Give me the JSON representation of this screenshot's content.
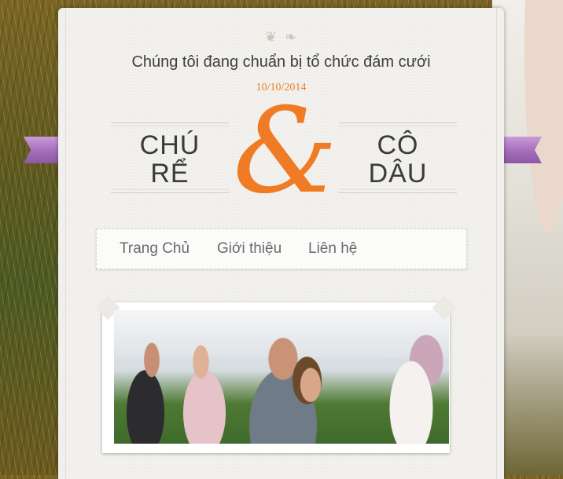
{
  "header": {
    "ornament": "❦ ❧",
    "tagline": "Chúng tôi đang chuẩn bị tổ chức đám cưới",
    "date": "10/10/2014"
  },
  "couple": {
    "groom": [
      "CHÚ",
      "RỂ"
    ],
    "bride": [
      "CÔ",
      "DÂU"
    ],
    "ampersand": "&"
  },
  "nav": {
    "items": [
      {
        "label": "Trang Chủ"
      },
      {
        "label": "Giới thiệu"
      },
      {
        "label": "Liên hệ"
      }
    ]
  },
  "colors": {
    "accent": "#ef7b25",
    "ribbon": "#a36dba",
    "paper": "#f2f1ed"
  }
}
